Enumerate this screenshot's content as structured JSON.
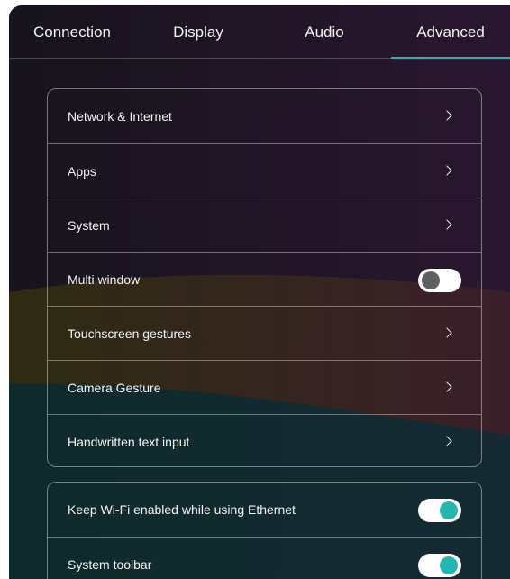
{
  "tabs": [
    {
      "label": "Connection"
    },
    {
      "label": "Display"
    },
    {
      "label": "Audio"
    },
    {
      "label": "Advanced",
      "active": true
    }
  ],
  "settings_group_1": [
    {
      "label": "Network & Internet",
      "control": "chevron"
    },
    {
      "label": "Apps",
      "control": "chevron"
    },
    {
      "label": "System",
      "control": "chevron"
    },
    {
      "label": "Multi window",
      "control": "toggle",
      "enabled": false
    },
    {
      "label": "Touchscreen gestures",
      "control": "chevron"
    },
    {
      "label": "Camera Gesture",
      "control": "chevron"
    },
    {
      "label": "Handwritten text input",
      "control": "chevron"
    }
  ],
  "settings_group_2": [
    {
      "label": "Keep Wi-Fi enabled while using Ethernet",
      "control": "toggle",
      "enabled": true
    },
    {
      "label": "System toolbar",
      "control": "toggle",
      "enabled": true
    }
  ],
  "colors": {
    "accent": "#2bb3b1",
    "toggle_on_knob": "#26b6b0",
    "toggle_off_knob": "#5d5f63",
    "background_top": "#1c1420",
    "wave_olive": "#2b2a12",
    "wave_teal": "#0f2a2c"
  },
  "icons": {
    "row_action": "chevron-right-icon"
  }
}
